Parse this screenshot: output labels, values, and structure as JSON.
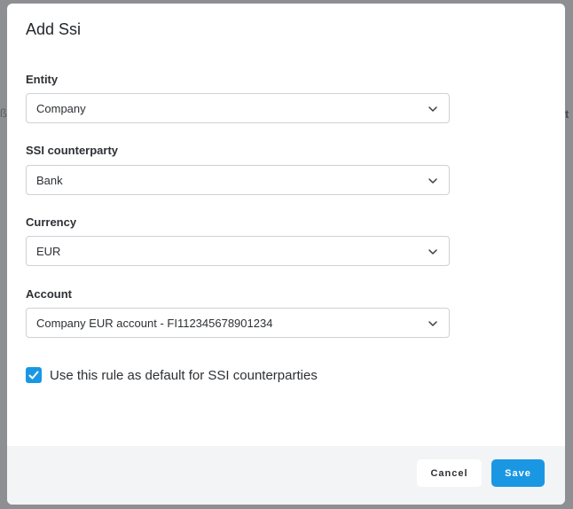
{
  "background_hints": {
    "left_fragment": "ß",
    "right_fragment": "t"
  },
  "modal": {
    "title": "Add Ssi",
    "fields": [
      {
        "label": "Entity",
        "value": "Company"
      },
      {
        "label": "SSI counterparty",
        "value": "Bank"
      },
      {
        "label": "Currency",
        "value": "EUR"
      },
      {
        "label": "Account",
        "value": "Company EUR account - FI112345678901234"
      }
    ],
    "default_rule": {
      "label": "Use this rule as default for SSI counterparties",
      "checked": true
    },
    "footer": {
      "cancel_label": "Cancel",
      "save_label": "Save"
    }
  },
  "colors": {
    "accent": "#1a97e3",
    "backdrop": "#8d8f93",
    "footer_bg": "#f3f4f6"
  },
  "icons": {
    "select_chevron": "chevron-down-icon",
    "checkbox": "check-icon"
  }
}
